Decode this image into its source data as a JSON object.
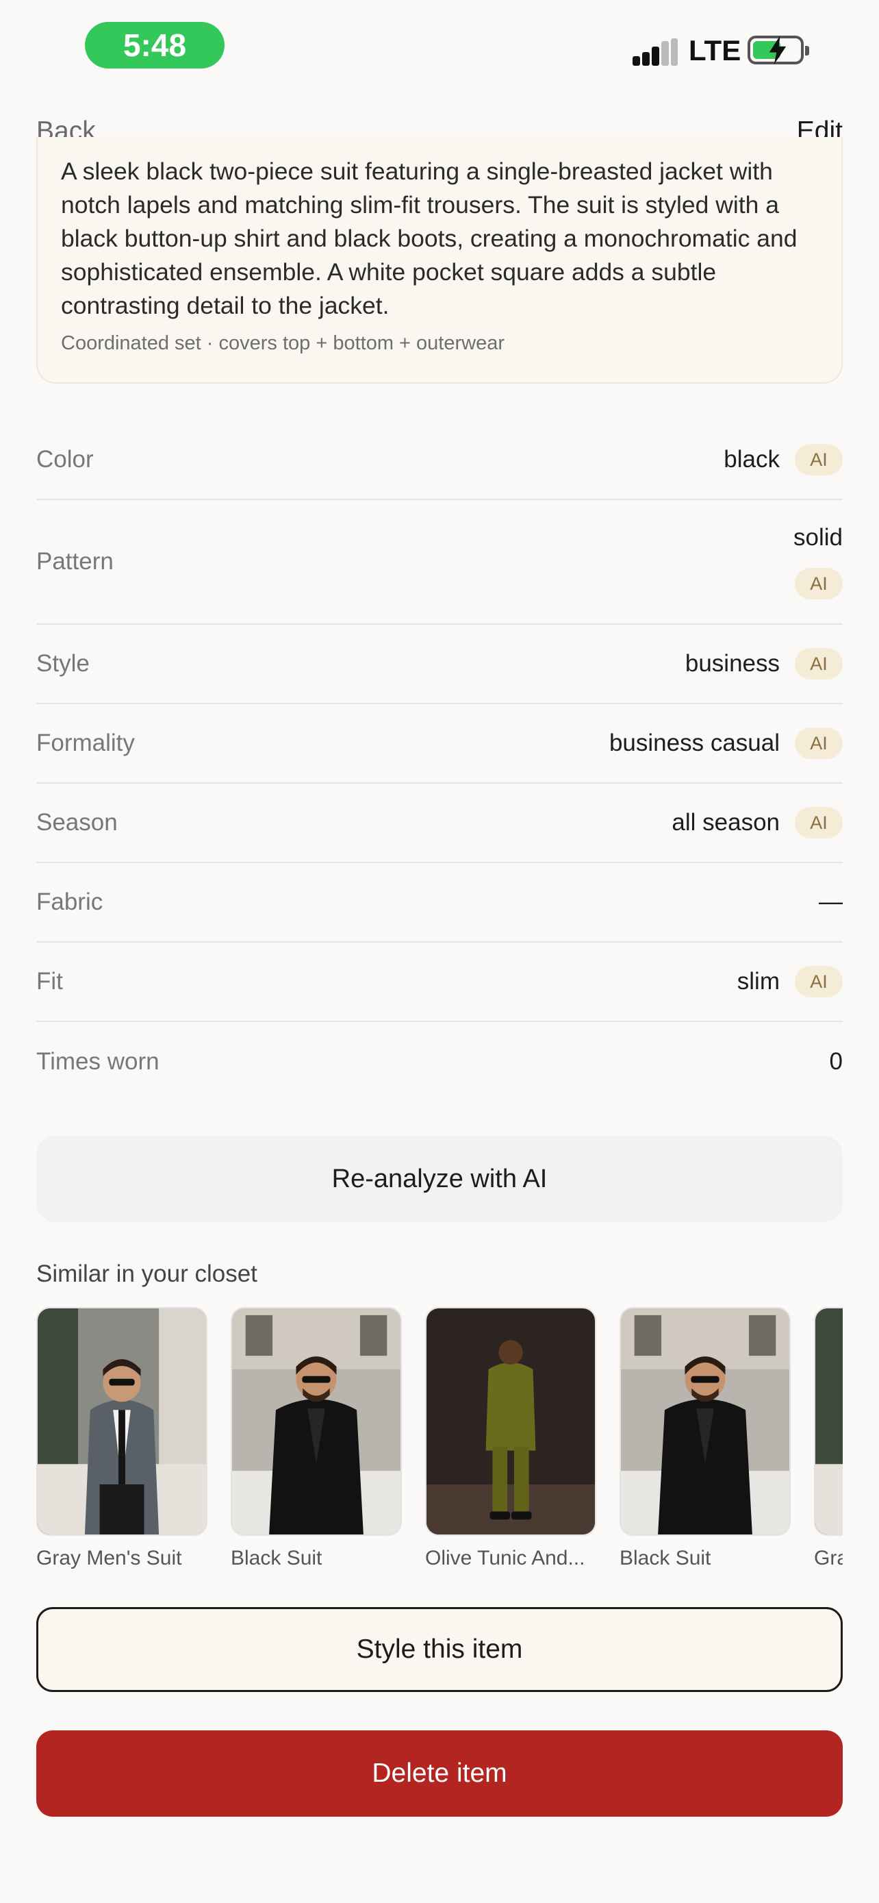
{
  "status_bar": {
    "time": "5:48",
    "network": "LTE",
    "icons": [
      "signal-icon",
      "battery-charging-icon"
    ],
    "time_pill_color": "#34c759"
  },
  "nav": {
    "back_label": "Back",
    "edit_label": "Edit"
  },
  "description": {
    "text": "A sleek black two-piece suit featuring a single-breasted jacket with notch lapels and matching slim-fit trousers. The suit is styled with a black button-up shirt and black boots, creating a monochromatic and sophisticated ensemble. A white pocket square adds a subtle contrasting detail to the jacket.",
    "note": "Coordinated set · covers top + bottom + outerwear"
  },
  "attributes": [
    {
      "label": "Color",
      "value": "black",
      "badge": "AI"
    },
    {
      "label": "Pattern",
      "value": "solid",
      "badge": "AI"
    },
    {
      "label": "Style",
      "value": "business",
      "badge": "AI"
    },
    {
      "label": "Formality",
      "value": "business casual",
      "badge": "AI"
    },
    {
      "label": "Season",
      "value": "all season",
      "badge": "AI"
    },
    {
      "label": "Fabric",
      "value": "—"
    },
    {
      "label": "Fit",
      "value": "slim",
      "badge": "AI"
    },
    {
      "label": "Times worn",
      "value": "0"
    }
  ],
  "reanalyze_label": "Re-analyze with AI",
  "similar": {
    "title": "Similar in your closet",
    "items": [
      {
        "name": "Gray Men's Suit"
      },
      {
        "name": "Black Suit"
      },
      {
        "name": "Olive Tunic And..."
      },
      {
        "name": "Black Suit"
      },
      {
        "name": "Gra"
      }
    ]
  },
  "actions": {
    "style_label": "Style this item",
    "delete_label": "Delete item",
    "delete_color": "#b32520"
  }
}
